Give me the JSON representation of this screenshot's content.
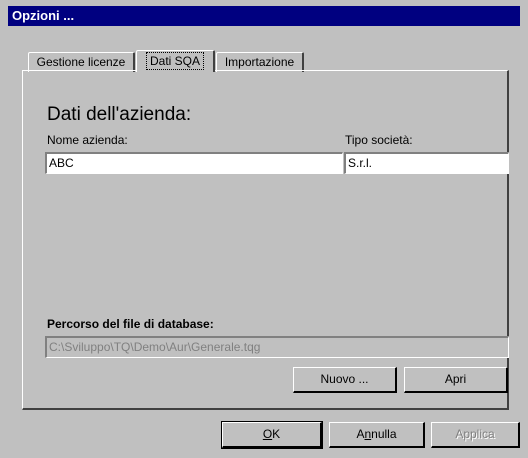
{
  "window": {
    "title": "Opzioni ..."
  },
  "tabs": [
    {
      "label": "Gestione licenze"
    },
    {
      "label": "Dati SQA"
    },
    {
      "label": "Importazione"
    }
  ],
  "company": {
    "heading": "Dati dell'azienda:",
    "name_label": "Nome azienda:",
    "name_value": "ABC",
    "type_label": "Tipo società:",
    "type_value": "S.r.l."
  },
  "database": {
    "label": "Percorso del file di database:",
    "path_value": "C:\\Sviluppo\\TQ\\Demo\\Aur\\Generale.tqg",
    "new_button": "Nuovo ...",
    "open_button": "Apri"
  },
  "footer": {
    "ok_key": "O",
    "ok_rest": "K",
    "cancel_pre": "A",
    "cancel_key": "n",
    "cancel_rest": "nulla",
    "apply": "Applica"
  }
}
